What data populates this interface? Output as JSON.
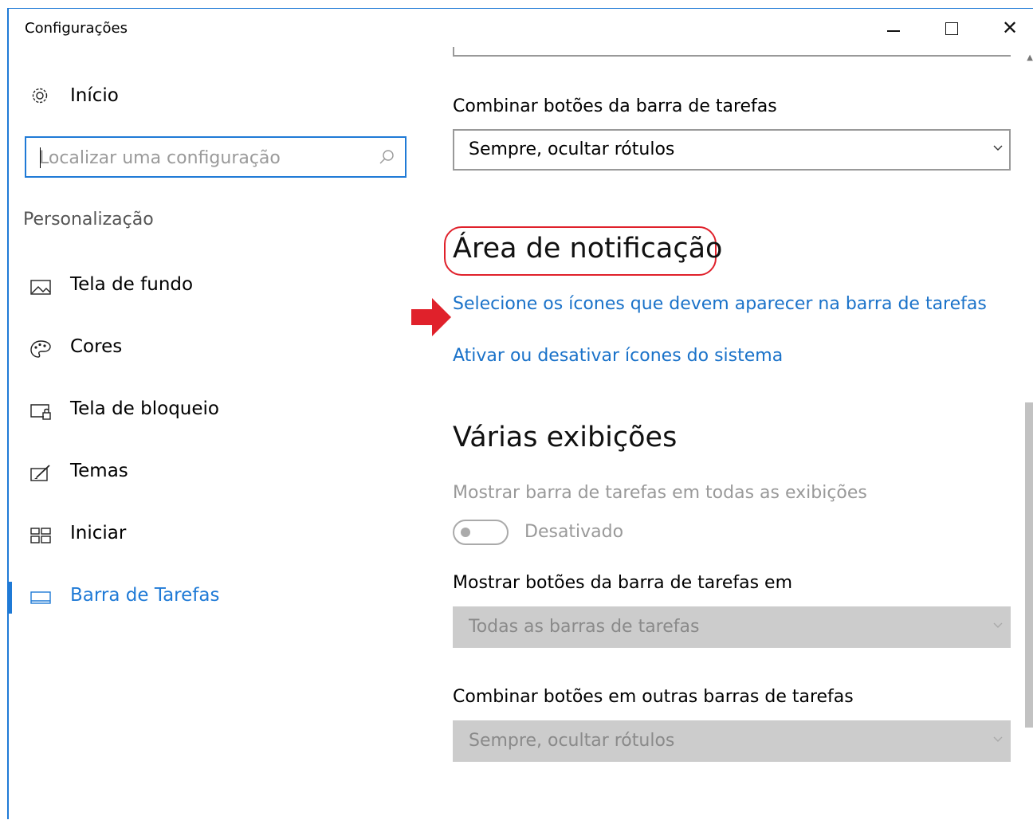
{
  "window": {
    "title": "Configurações"
  },
  "sidebar": {
    "home_label": "Início",
    "search": {
      "placeholder": "Localizar uma configuração"
    },
    "section_label": "Personalização",
    "items": [
      {
        "label": "Tela de fundo",
        "icon": "picture-icon"
      },
      {
        "label": "Cores",
        "icon": "palette-icon"
      },
      {
        "label": "Tela de bloqueio",
        "icon": "lock-screen-icon"
      },
      {
        "label": "Temas",
        "icon": "themes-icon"
      },
      {
        "label": "Iniciar",
        "icon": "start-icon"
      },
      {
        "label": "Barra de Tarefas",
        "icon": "taskbar-icon",
        "active": true
      }
    ]
  },
  "main": {
    "combine_label": "Combinar botões da barra de tarefas",
    "combine_value": "Sempre, ocultar rótulos",
    "notification_heading": "Área de notificação",
    "link_select_icons": "Selecione os ícones que devem aparecer na barra de tarefas",
    "link_system_icons": "Ativar ou desativar ícones do sistema",
    "multi_heading": "Várias exibições",
    "show_all_label": "Mostrar barra de tarefas em todas as exibições",
    "toggle_state": "Desativado",
    "show_buttons_label": "Mostrar botões da barra de tarefas em",
    "show_buttons_value": "Todas as barras de tarefas",
    "combine_other_label": "Combinar botões em outras barras de tarefas",
    "combine_other_value": "Sempre, ocultar rótulos"
  },
  "colors": {
    "accent": "#1f7ad6",
    "link": "#1a72c9",
    "annotation": "#e0212b"
  }
}
